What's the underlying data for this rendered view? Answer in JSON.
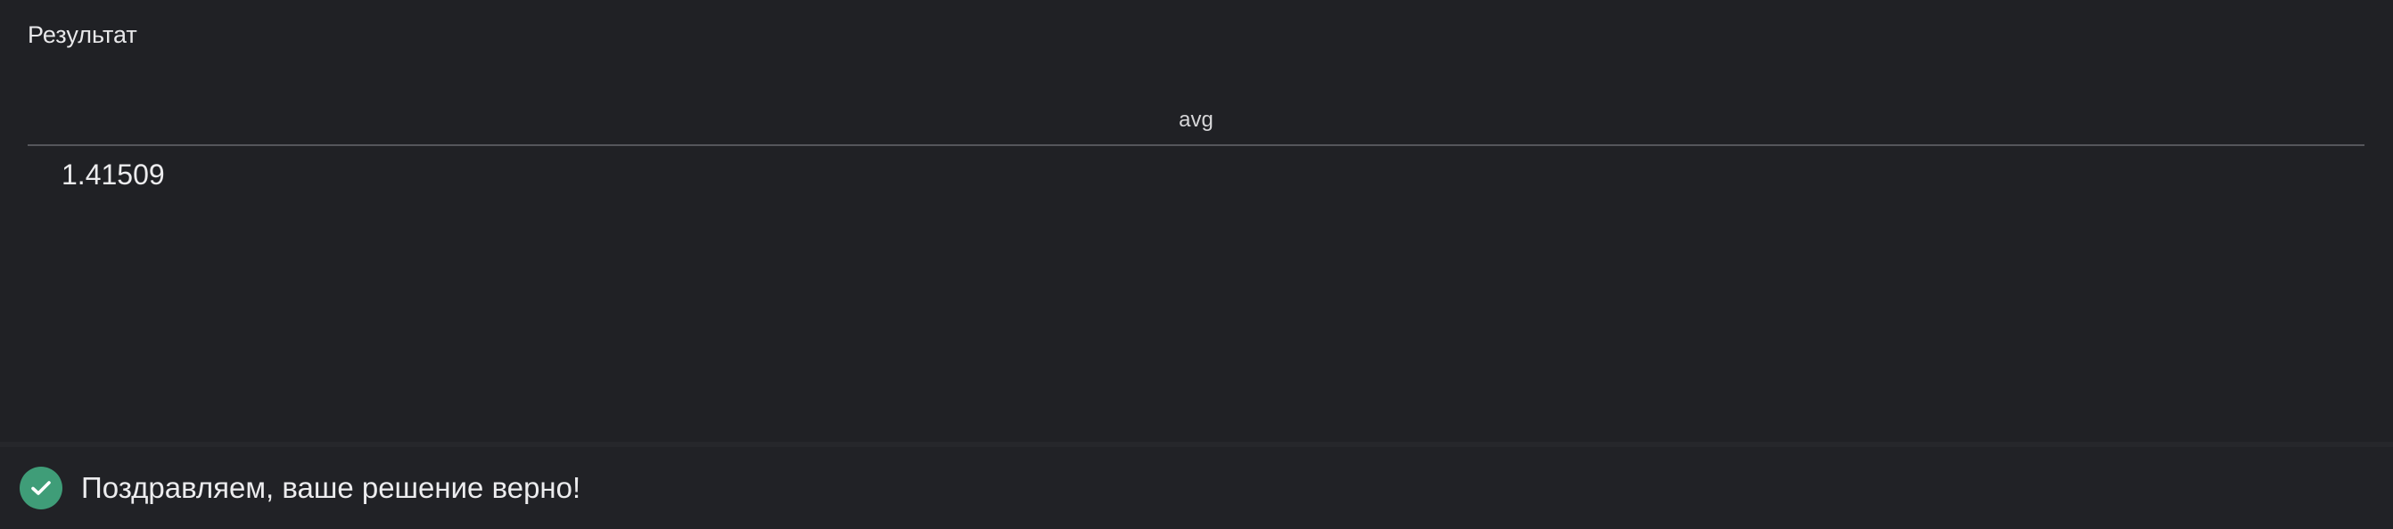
{
  "result": {
    "title": "Результат",
    "table": {
      "columns": [
        "avg"
      ],
      "rows": [
        [
          "1.41509"
        ]
      ]
    }
  },
  "status": {
    "icon": "check-circle-icon",
    "message": "Поздравляем, ваше решение верно!",
    "color": "#3f9d78"
  },
  "colors": {
    "background": "#202125",
    "text": "#e8e8ea",
    "divider": "#55565b",
    "success": "#3f9d78"
  }
}
